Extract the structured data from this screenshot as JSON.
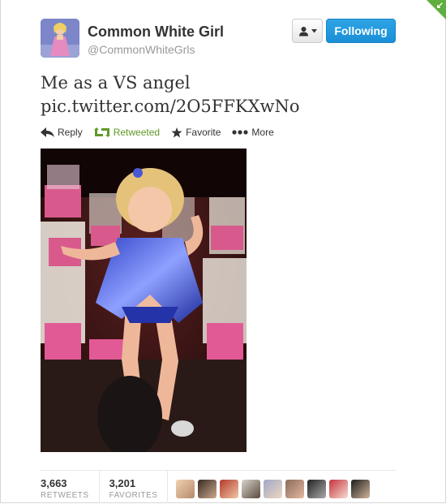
{
  "user": {
    "full_name": "Common White Girl",
    "screen_name": "@CommonWhiteGrls"
  },
  "buttons": {
    "following_label": "Following",
    "user_actions_icon": "person-icon"
  },
  "tweet": {
    "line1": "Me as a VS angel",
    "line2": "pic.twitter.com/2O5FFKXwNo"
  },
  "actions": {
    "reply": "Reply",
    "retweeted": "Retweeted",
    "favorite": "Favorite",
    "more": "More"
  },
  "stats": {
    "retweets_count": "3,663",
    "retweets_label": "RETWEETS",
    "favorites_count": "3,201",
    "favorites_label": "FAVORITES"
  },
  "colors": {
    "retweeted_green": "#609928",
    "follow_blue": "#2ea4e6",
    "corner_green": "#5fae3f"
  }
}
